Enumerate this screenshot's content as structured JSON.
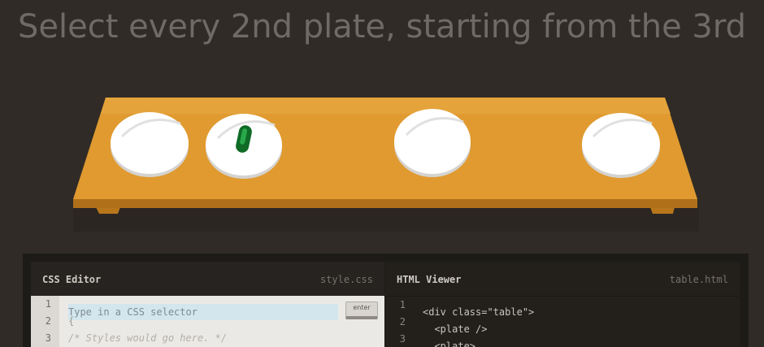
{
  "instruction": "Select every 2nd plate, starting from the 3rd",
  "table": {
    "color": "#e09a30",
    "plates": [
      {
        "item": null
      },
      {
        "item": "pickle"
      },
      {
        "item": null
      },
      {
        "item": null
      }
    ]
  },
  "css_editor": {
    "title": "CSS Editor",
    "filename": "style.css",
    "line_numbers": [
      "1",
      "2",
      "3"
    ],
    "input_placeholder": "Type in a CSS selector",
    "enter_label": "enter",
    "brace_open": "{",
    "comment": "/* Styles would go here. */"
  },
  "html_viewer": {
    "title": "HTML Viewer",
    "filename": "table.html",
    "line_numbers": [
      "1",
      "2",
      "3"
    ],
    "lines": [
      "<div class=\"table\">",
      "  <plate />",
      "  <plate>"
    ]
  }
}
